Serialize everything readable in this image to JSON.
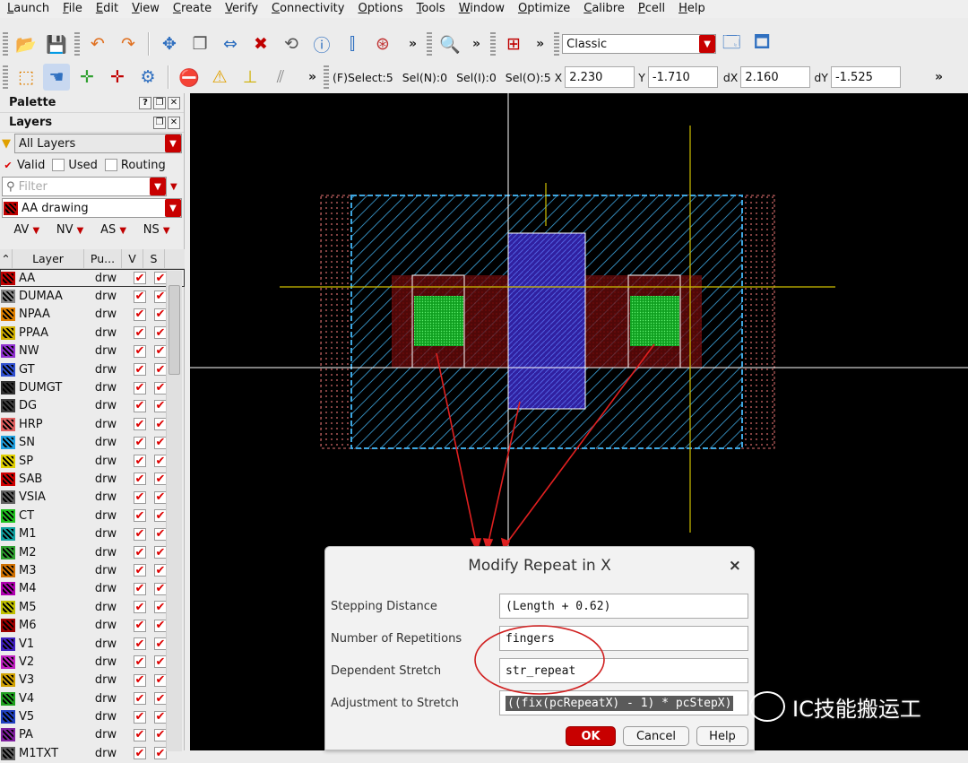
{
  "menubar": [
    "Launch",
    "File",
    "Edit",
    "View",
    "Create",
    "Verify",
    "Connectivity",
    "Options",
    "Tools",
    "Window",
    "Optimize",
    "Calibre",
    "Pcell",
    "Help"
  ],
  "toolbar": {
    "workspace": "Classic",
    "status": {
      "select": "(F)Select:5",
      "seln": "Sel(N):0",
      "seli": "Sel(I):0",
      "selo": "Sel(O):5"
    },
    "coords": {
      "x_label": "X",
      "x": "2.230",
      "y_label": "Y",
      "y": "-1.710",
      "dx_label": "dX",
      "dx": "2.160",
      "dy_label": "dY",
      "dy": "-1.525"
    },
    "more": "»"
  },
  "palette": {
    "title": "Palette",
    "layers_title": "Layers",
    "filter_all": "All Layers",
    "valid": "Valid",
    "used": "Used",
    "routing": "Routing",
    "filter_placeholder": "Filter",
    "current_layer": "AA drawing",
    "vis": [
      "AV",
      "NV",
      "AS",
      "NS"
    ],
    "columns": [
      "Layer",
      "Pu...",
      "V",
      "S"
    ],
    "rows": [
      {
        "name": "AA",
        "purpose": "drw",
        "color": "#c00000"
      },
      {
        "name": "DUMAA",
        "purpose": "drw",
        "color": "#888888"
      },
      {
        "name": "NPAA",
        "purpose": "drw",
        "color": "#e08000"
      },
      {
        "name": "PPAA",
        "purpose": "drw",
        "color": "#d0b000"
      },
      {
        "name": "NW",
        "purpose": "drw",
        "color": "#9030d0"
      },
      {
        "name": "GT",
        "purpose": "drw",
        "color": "#3050d0"
      },
      {
        "name": "DUMGT",
        "purpose": "drw",
        "color": "#303030"
      },
      {
        "name": "DG",
        "purpose": "drw",
        "color": "#404040"
      },
      {
        "name": "HRP",
        "purpose": "drw",
        "color": "#e06060"
      },
      {
        "name": "SN",
        "purpose": "drw",
        "color": "#20a0e0"
      },
      {
        "name": "SP",
        "purpose": "drw",
        "color": "#e0d000"
      },
      {
        "name": "SAB",
        "purpose": "drw",
        "color": "#d00000"
      },
      {
        "name": "VSIA",
        "purpose": "drw",
        "color": "#606060"
      },
      {
        "name": "CT",
        "purpose": "drw",
        "color": "#20c020"
      },
      {
        "name": "M1",
        "purpose": "drw",
        "color": "#10a0a0"
      },
      {
        "name": "M2",
        "purpose": "drw",
        "color": "#30a030"
      },
      {
        "name": "M3",
        "purpose": "drw",
        "color": "#d07000"
      },
      {
        "name": "M4",
        "purpose": "drw",
        "color": "#b000b0"
      },
      {
        "name": "M5",
        "purpose": "drw",
        "color": "#c0c000"
      },
      {
        "name": "M6",
        "purpose": "drw",
        "color": "#a00000"
      },
      {
        "name": "V1",
        "purpose": "drw",
        "color": "#4020c0"
      },
      {
        "name": "V2",
        "purpose": "drw",
        "color": "#c020c0"
      },
      {
        "name": "V3",
        "purpose": "drw",
        "color": "#d0a000"
      },
      {
        "name": "V4",
        "purpose": "drw",
        "color": "#20a020"
      },
      {
        "name": "V5",
        "purpose": "drw",
        "color": "#2040c0"
      },
      {
        "name": "PA",
        "purpose": "drw",
        "color": "#8020a0"
      },
      {
        "name": "M1TXT",
        "purpose": "drw",
        "color": "#606060"
      }
    ]
  },
  "dialog": {
    "title": "Modify Repeat in X",
    "close": "×",
    "fields": [
      {
        "label": "Stepping Distance",
        "value": "(Length + 0.62)"
      },
      {
        "label": "Number of Repetitions",
        "value": "fingers"
      },
      {
        "label": "Dependent Stretch",
        "value": "str_repeat"
      },
      {
        "label": "Adjustment to Stretch",
        "value": "((fix(pcRepeatX) - 1) * pcStepX)"
      }
    ],
    "ok": "OK",
    "cancel": "Cancel",
    "help": "Help"
  },
  "watermark": "IC技能搬运工",
  "colors": {
    "accent": "#c80000",
    "canvas": "#000000",
    "diffusion": "#3ea6e0",
    "gate": "#2040c0",
    "contact": "#20c030",
    "implant": "#a01010"
  }
}
